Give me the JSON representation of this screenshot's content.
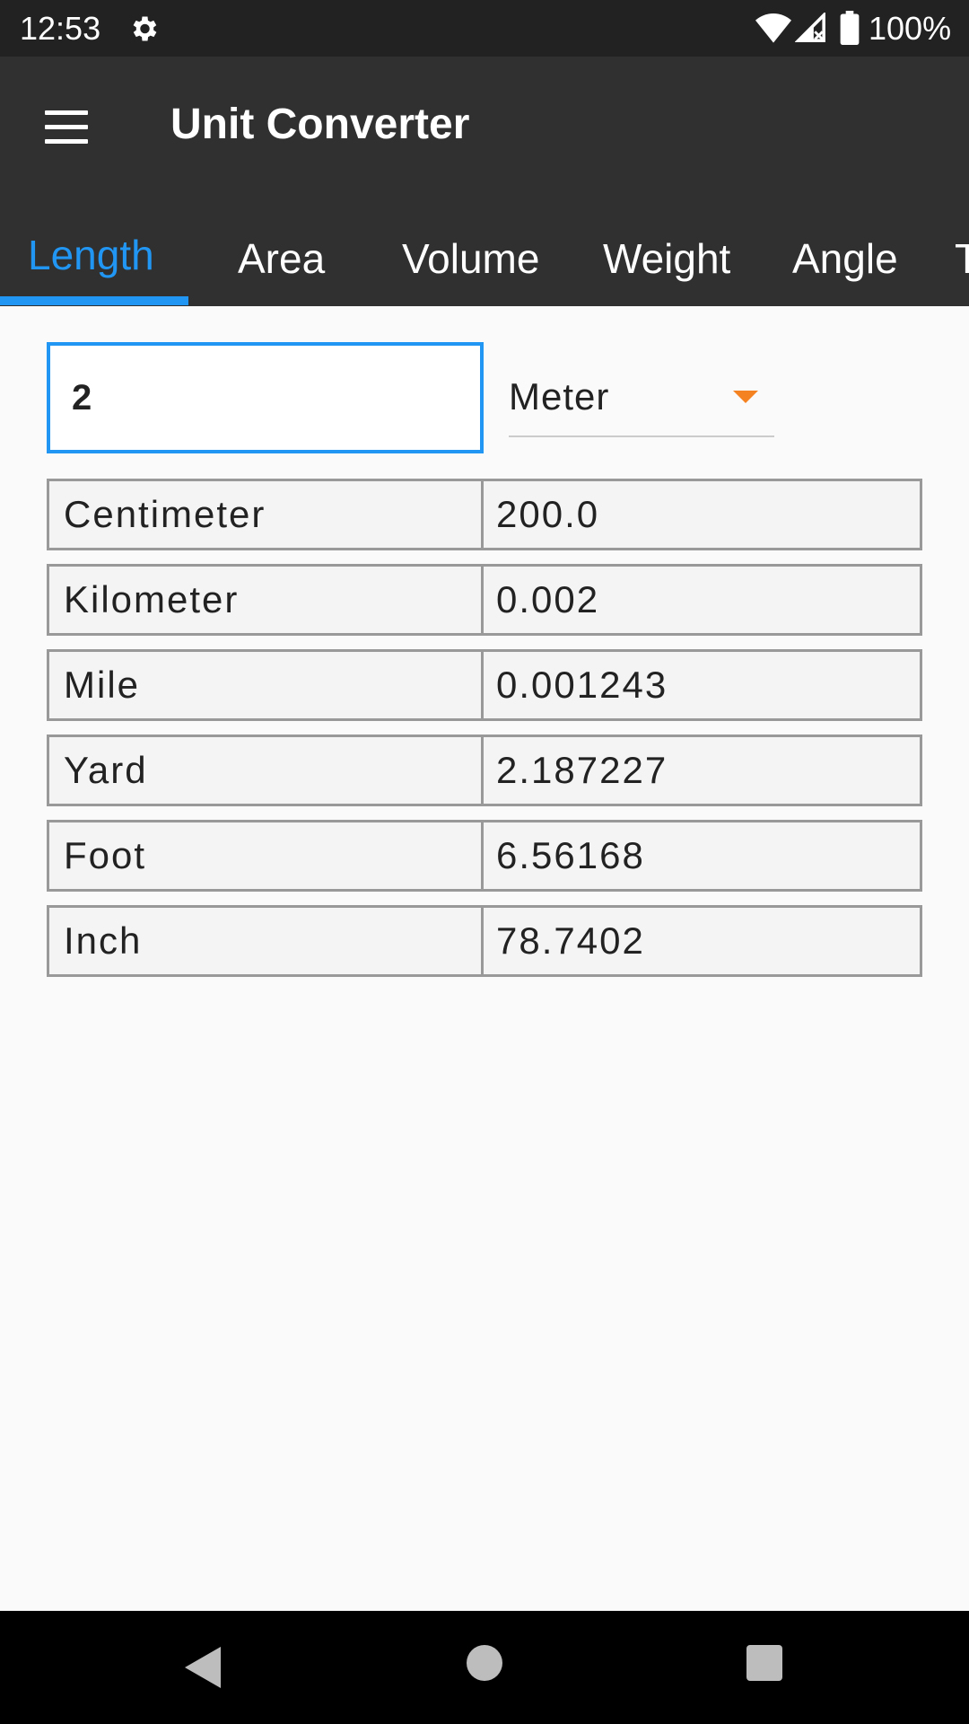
{
  "status_bar": {
    "time": "12:53",
    "battery": "100%",
    "icons": [
      "settings-gear-icon",
      "wifi-icon",
      "signal-icon",
      "battery-icon"
    ]
  },
  "app_bar": {
    "title": "Unit Converter",
    "menu_icon": "hamburger-menu-icon"
  },
  "tabs": [
    {
      "label": "Length",
      "active": true
    },
    {
      "label": "Area",
      "active": false
    },
    {
      "label": "Volume",
      "active": false
    },
    {
      "label": "Weight",
      "active": false
    },
    {
      "label": "Angle",
      "active": false
    },
    {
      "label": "T",
      "active": false
    }
  ],
  "converter": {
    "input_value": "2",
    "selected_unit": "Meter"
  },
  "results": [
    {
      "unit": "Centimeter",
      "value": "200.0"
    },
    {
      "unit": "Kilometer",
      "value": "0.002"
    },
    {
      "unit": "Mile",
      "value": "0.001243"
    },
    {
      "unit": "Yard",
      "value": "2.187227"
    },
    {
      "unit": "Foot",
      "value": "6.56168"
    },
    {
      "unit": "Inch",
      "value": "78.7402"
    }
  ],
  "colors": {
    "accent": "#2196f3",
    "dropdown_arrow": "#f58220",
    "app_bar": "#303030",
    "status_bar": "#222222"
  },
  "nav_bar": {
    "icons": [
      "back-icon",
      "home-icon",
      "recent-apps-icon"
    ]
  }
}
